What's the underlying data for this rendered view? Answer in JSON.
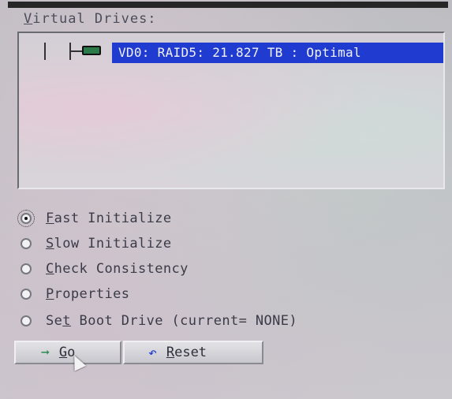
{
  "panel": {
    "title_prefix": "V",
    "title_rest": "irtual Drives:"
  },
  "virtual_drives": [
    {
      "label": "VD0: RAID5: 21.827 TB : Optimal"
    }
  ],
  "options": [
    {
      "underlined": "F",
      "rest": "ast Initialize",
      "checked": true
    },
    {
      "underlined": "S",
      "rest": "low Initialize",
      "checked": false
    },
    {
      "underlined": "C",
      "rest": "heck Consistency",
      "checked": false
    },
    {
      "underlined": "P",
      "rest": "roperties",
      "checked": false
    },
    {
      "prefix": "Se",
      "underlined": "t",
      "rest": " Boot Drive (current= NONE)",
      "checked": false
    }
  ],
  "buttons": {
    "go": {
      "underlined": "G",
      "rest": "o"
    },
    "reset": {
      "underlined": "R",
      "rest": "eset"
    }
  },
  "colors": {
    "selection": "#1f3bd0",
    "drive_icon": "#2a7a4a"
  },
  "icons": {
    "go": "go-arrow-icon",
    "reset": "reset-undo-icon"
  }
}
